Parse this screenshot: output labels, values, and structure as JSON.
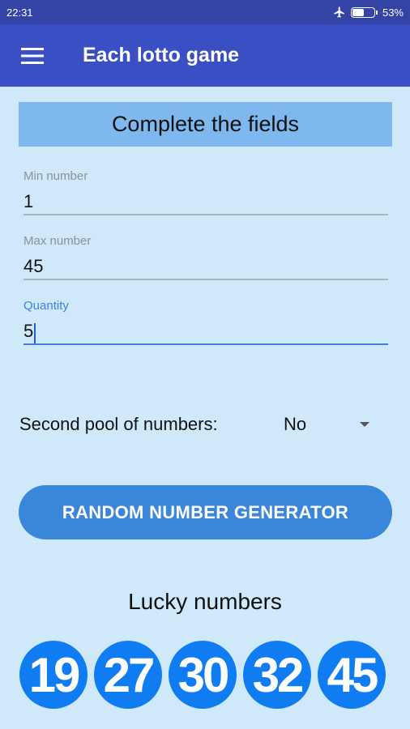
{
  "status_bar": {
    "time": "22:31",
    "battery": "53%",
    "battery_level": 0.53,
    "airplane_icon": "airplane-icon"
  },
  "app_bar": {
    "menu_icon": "menu-icon",
    "title": "Each lotto game"
  },
  "header": "Complete the fields",
  "fields": [
    {
      "label": "Min number",
      "value": "1"
    },
    {
      "label": "Max number",
      "value": "45"
    },
    {
      "label": "Quantity",
      "value": "5"
    }
  ],
  "second_pool": {
    "label": "Second pool of numbers:",
    "value": "No"
  },
  "generate_button": "RANDOM NUMBER GENERATOR",
  "lucky": {
    "title": "Lucky numbers",
    "numbers": [
      "19",
      "27",
      "30",
      "32",
      "45"
    ]
  },
  "colors": {
    "status_bar": "#3343a6",
    "app_bar": "#3b4fc4",
    "background": "#cfe9fb",
    "header_box": "#7fb8ee",
    "button": "#3a86db",
    "ball": "#0f7cf2",
    "accent": "#3f7fe0"
  }
}
